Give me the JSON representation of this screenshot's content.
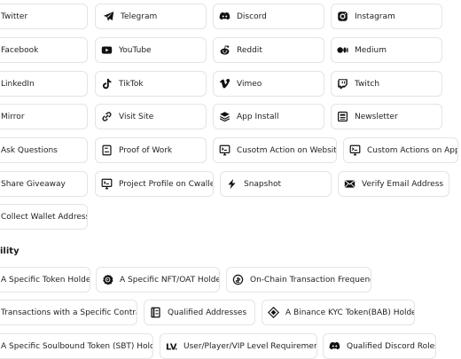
{
  "social": {
    "twitter": "Twitter",
    "telegram": "Telegram",
    "discord": "Discord",
    "instagram": "Instagram",
    "facebook": "Facebook",
    "youtube": "YouTube",
    "reddit": "Reddit",
    "medium": "Medium",
    "linkedin": "LinkedIn",
    "tiktok": "TikTok",
    "vimeo": "Vimeo",
    "twitch": "Twitch",
    "mirror": "Mirror",
    "visit_site": "Visit Site",
    "app_install": "App Install",
    "newsletter": "Newsletter",
    "ask_questions": "Ask Questions",
    "proof_of_work": "Proof of Work",
    "custom_action_website": "Cusotm Action on Website",
    "custom_actions_app": "Custom Actions on App",
    "share_giveaway": "Share Giveaway",
    "project_profile": "Project Profile on Cwallet",
    "snapshot": "Snapshot",
    "verify_email": "Verify Email Address",
    "collect_wallet": "Collect Wallet Address"
  },
  "eligibility": {
    "heading": "ility",
    "token_holder": "A Specific Token Holder",
    "nft_holder": "A Specific NFT/OAT Holder",
    "tx_frequency": "On-Chain Transaction Frequency",
    "tx_contract": "Transactions with a Specific Contract",
    "qualified_addresses": "Qualified Addresses",
    "bab_holder": "A Binance KYC Token(BAB) Holder",
    "sbt_holder": "A Specific Soulbound Token (SBT) Holder",
    "level_req": "User/Player/VIP Level Requirement",
    "discord_roles": "Qualified Discord Roles"
  },
  "icons": {
    "telegram": "telegram-icon",
    "discord": "discord-icon",
    "instagram": "instagram-icon",
    "youtube": "youtube-icon",
    "reddit": "reddit-icon",
    "medium": "medium-icon",
    "tiktok": "tiktok-icon",
    "vimeo": "vimeo-icon",
    "twitch": "twitch-icon",
    "link": "link-icon",
    "stack": "layers-icon",
    "newsletter": "newsletter-icon",
    "document": "document-icon",
    "action": "custom-action-icon",
    "flash": "flash-icon",
    "mail": "envelope-icon",
    "nft": "nft-badge-icon",
    "coin": "transaction-frequency-icon",
    "diamond": "bab-token-icon",
    "level": "level-icon"
  },
  "colors": {
    "border": "#e4e4e7",
    "text": "#1f1f1f",
    "background": "#ffffff"
  }
}
